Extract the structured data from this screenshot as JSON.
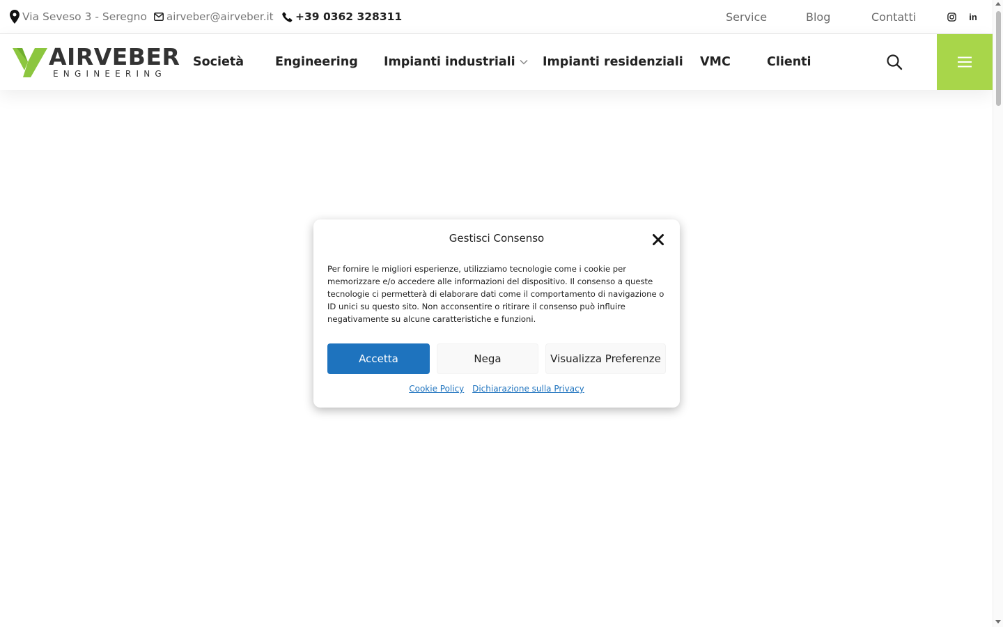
{
  "topbar": {
    "address": "Via Seveso 3 - Seregno",
    "email": "airveber@airveber.it",
    "phone": "+39 0362 328311",
    "links": {
      "service": "Service",
      "blog": "Blog",
      "contatti": "Contatti"
    },
    "social": {
      "instagram_icon": "instagram-icon",
      "linkedin_label": "in"
    }
  },
  "header": {
    "logo": {
      "word": "AIRVEBER",
      "sub": "ENGINEERING"
    },
    "nav": {
      "societa": "Società",
      "engineering": "Engineering",
      "industriali": "Impianti industriali",
      "residenziali": "Impianti residenziali",
      "vmc": "VMC",
      "clienti": "Clienti"
    }
  },
  "consent": {
    "title": "Gestisci Consenso",
    "text": "Per fornire le migliori esperienze, utilizziamo tecnologie come i cookie per memorizzare e/o accedere alle informazioni del dispositivo. Il consenso a queste tecnologie ci permetterà di elaborare dati come il comportamento di navigazione o ID unici su questo sito. Non acconsentire o ritirare il consenso può influire negativamente su alcune caratteristiche e funzioni.",
    "buttons": {
      "accept": "Accetta",
      "deny": "Nega",
      "preferences": "Visualizza Preferenze"
    },
    "links": {
      "cookie_policy": "Cookie Policy",
      "privacy": "Dichiarazione sulla Privacy"
    }
  },
  "colors": {
    "brand_green": "#a8d64a",
    "accept_blue": "#1e73be",
    "logo_dark": "#333333"
  }
}
